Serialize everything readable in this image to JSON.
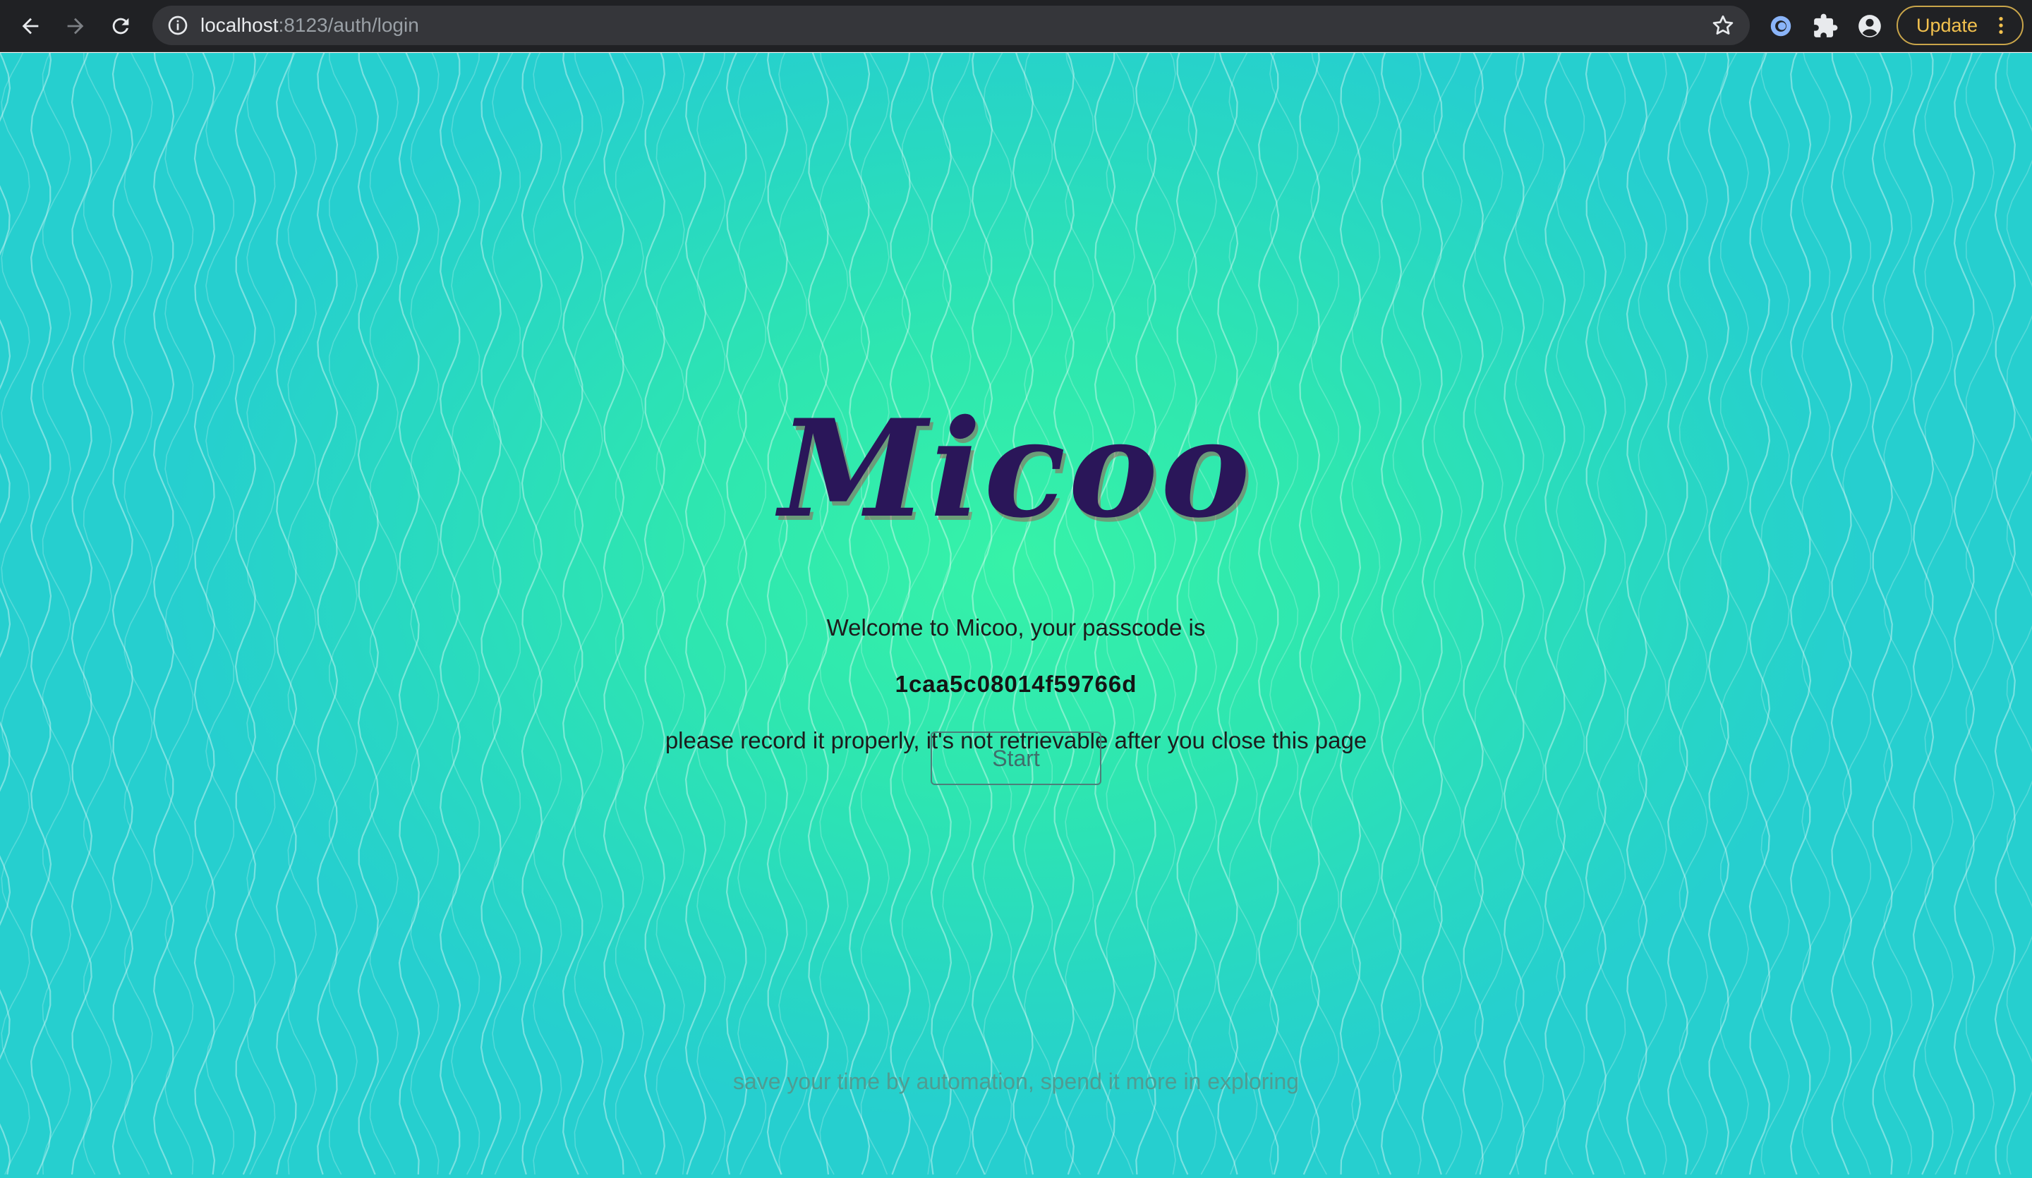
{
  "browser": {
    "url_host": "localhost",
    "url_path": ":8123/auth/login",
    "update_label": "Update"
  },
  "page": {
    "logo_text": "Micoo",
    "welcome_text": "Welcome to Micoo, your passcode is",
    "passcode": "1caa5c08014f59766d",
    "notice_text": "please record it properly, it's not retrievable after you close this page",
    "start_label": "Start",
    "tagline": "save your time by automation, spend it more in exploring"
  },
  "colors": {
    "logo": "#2a1659",
    "background_center": "#36f2a8",
    "background_edge": "#26cfcf",
    "update_accent": "#f2c14e"
  }
}
